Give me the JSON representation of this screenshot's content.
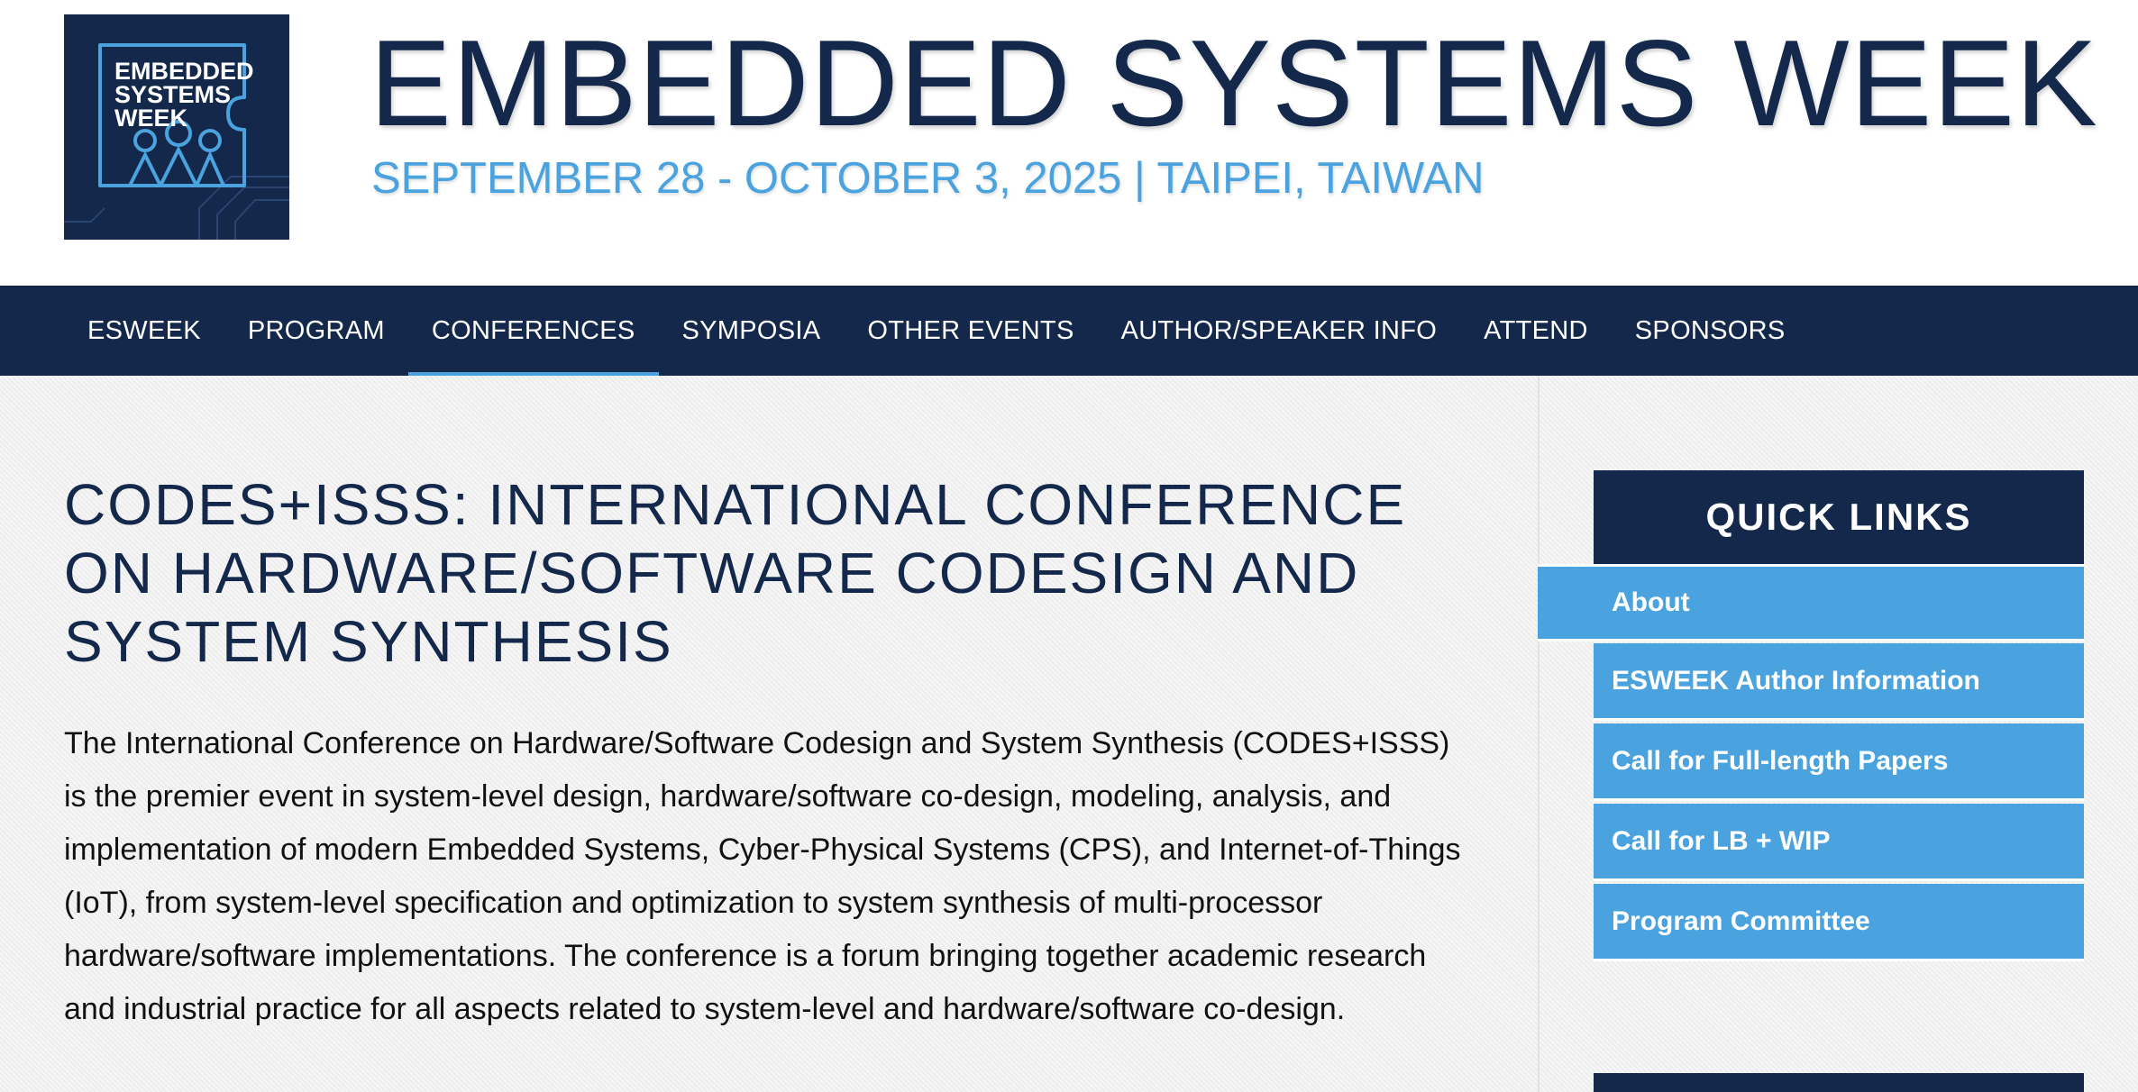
{
  "header": {
    "logo_text": [
      "EMBEDDED",
      "SYSTEMS",
      "WEEK"
    ],
    "title": "EMBEDDED SYSTEMS WEEK",
    "subtitle": "SEPTEMBER 28 - OCTOBER 3, 2025 | TAIPEI, TAIWAN"
  },
  "nav": {
    "items": [
      {
        "label": "ESWEEK"
      },
      {
        "label": "PROGRAM"
      },
      {
        "label": "CONFERENCES"
      },
      {
        "label": "SYMPOSIA"
      },
      {
        "label": "OTHER EVENTS"
      },
      {
        "label": "AUTHOR/SPEAKER INFO"
      },
      {
        "label": "ATTEND"
      },
      {
        "label": "SPONSORS"
      }
    ],
    "active": "CONFERENCES"
  },
  "main": {
    "title": "CODES+ISSS: INTERNATIONAL CONFERENCE ON HARDWARE/SOFTWARE CODESIGN AND SYSTEM SYNTHESIS",
    "intro": "The International Conference on Hardware/Software Codesign and System Synthesis (CODES+ISSS) is the premier event in system-level design, hardware/software co-design, modeling, analysis, and implementation of modern Embedded Systems, Cyber-Physical Systems (CPS), and Internet-of-Things (IoT), from system-level specification and optimization to system synthesis of multi-processor hardware/software implementations. The conference is a forum bringing together academic research and industrial practice for all aspects related to system-level and hardware/software co-design."
  },
  "sidebar": {
    "quick_links_title": "QUICK LINKS",
    "links": [
      {
        "label": "About"
      },
      {
        "label": "ESWEEK Author Information"
      },
      {
        "label": "Call for Full-length Papers"
      },
      {
        "label": "Call for LB + WIP"
      },
      {
        "label": "Program Committee"
      }
    ],
    "active": "About"
  },
  "colors": {
    "navy": "#13284a",
    "accent_blue": "#4aa3df",
    "background": "#f1f1f1"
  }
}
